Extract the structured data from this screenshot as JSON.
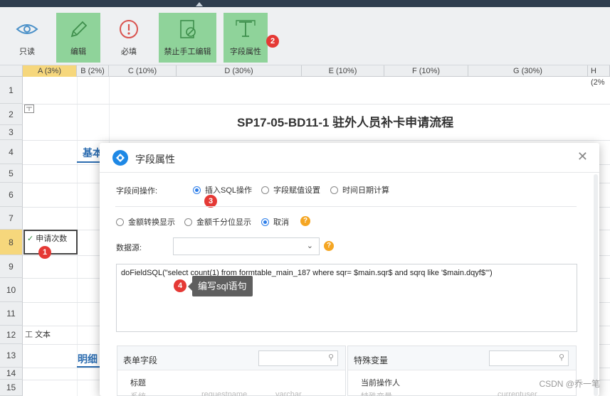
{
  "toolbar": {
    "buttons": [
      {
        "label": "只读",
        "icon": "eye-icon",
        "active": false
      },
      {
        "label": "编辑",
        "icon": "pencil-icon",
        "active": true
      },
      {
        "label": "必填",
        "icon": "exclamation-icon",
        "active": false
      },
      {
        "label": "禁止手工编辑",
        "icon": "no-edit-icon",
        "active": true
      },
      {
        "label": "字段属性",
        "icon": "text-field-icon",
        "active": true
      }
    ]
  },
  "badges": {
    "b1": "1",
    "b2": "2",
    "b3": "3",
    "b4": "4"
  },
  "grid": {
    "columns": [
      "A (3%)",
      "B (2%)",
      "C (10%)",
      "D (30%)",
      "E (10%)",
      "F (10%)",
      "G (30%)",
      "H (2%"
    ],
    "rows": [
      "1",
      "2",
      "3",
      "4",
      "5",
      "6",
      "7",
      "8",
      "9",
      "10",
      "11",
      "12",
      "13",
      "14",
      "15"
    ],
    "title": "SP17-05-BD11-1 驻外人员补卡申请流程",
    "section1": "基本",
    "section2": "明细",
    "field_cell_label": "申请次数",
    "text_label": "文本"
  },
  "dialog": {
    "title": "字段属性",
    "field_ops_label": "字段间操作:",
    "field_ops": [
      {
        "label": "插入SQL操作",
        "checked": true
      },
      {
        "label": "字段赋值设置",
        "checked": false
      },
      {
        "label": "时间日期计算",
        "checked": false
      }
    ],
    "amount_options": [
      {
        "label": "金额转换显示",
        "checked": false
      },
      {
        "label": "金额千分位显示",
        "checked": false
      },
      {
        "label": "取消",
        "checked": true
      }
    ],
    "datasource_label": "数据源:",
    "datasource_value": "",
    "sql_text": "doFieldSQL(\"select count(1) from formtable_main_187 where sqr= $main.sqr$ and sqrq like '$main.dqyf$'\")",
    "tooltip": "编写sql语句",
    "help_glyph": "?",
    "left_panel": {
      "title": "表单字段",
      "item": "标题",
      "faded": [
        "系统",
        "requestname",
        "varchar"
      ]
    },
    "right_panel": {
      "title": "特殊变量",
      "item": "当前操作人",
      "faded": [
        "特殊变量",
        "currentuser"
      ]
    }
  },
  "watermark": "CSDN @乔一笔"
}
